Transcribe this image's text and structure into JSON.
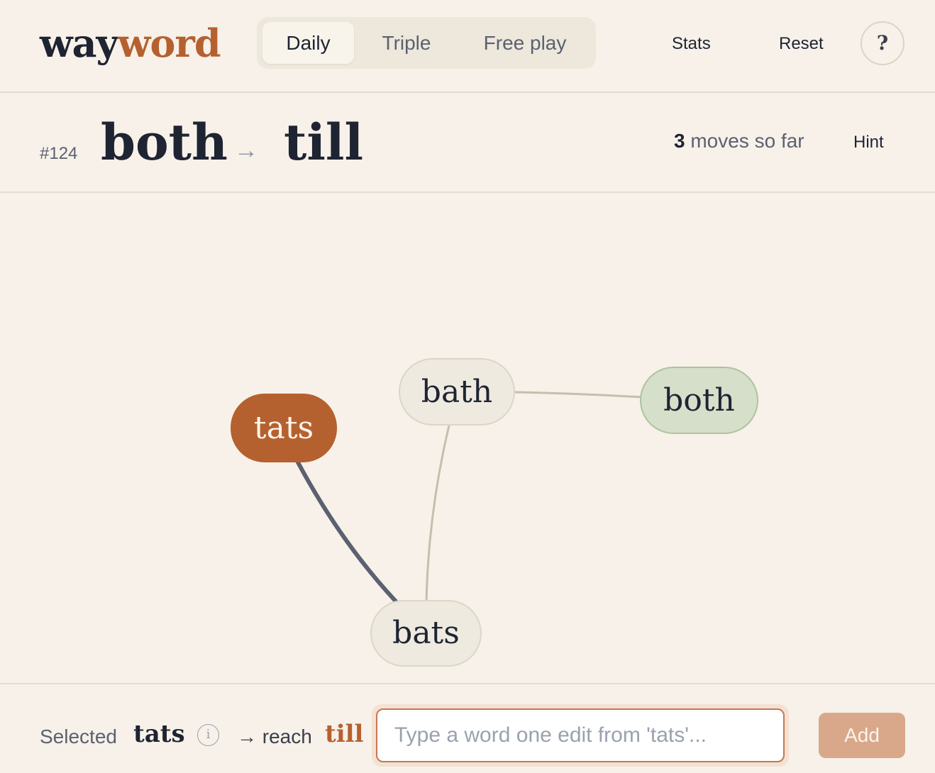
{
  "app": {
    "logo_part1": "way",
    "logo_part2": "word"
  },
  "header": {
    "modes": [
      {
        "label": "Daily",
        "active": true
      },
      {
        "label": "Triple",
        "active": false
      },
      {
        "label": "Free play",
        "active": false
      }
    ],
    "stats_label": "Stats",
    "reset_label": "Reset",
    "help_label": "?"
  },
  "puzzle": {
    "number": "#124",
    "start_word": "both",
    "arrow": "→",
    "target_word": "till",
    "moves_count": "3",
    "moves_suffix": "moves so far",
    "hint_label": "Hint"
  },
  "graph": {
    "nodes": [
      {
        "id": "tats",
        "label": "tats",
        "state": "selected"
      },
      {
        "id": "bath",
        "label": "bath",
        "state": "plain"
      },
      {
        "id": "both",
        "label": "both",
        "state": "start"
      },
      {
        "id": "bats",
        "label": "bats",
        "state": "plain"
      }
    ],
    "edges": [
      {
        "from": "bath",
        "to": "both",
        "highlighted": false
      },
      {
        "from": "bath",
        "to": "bats",
        "highlighted": false
      },
      {
        "from": "tats",
        "to": "bats",
        "highlighted": true
      }
    ],
    "colors": {
      "edge": "#c4bfae",
      "edge_highlight": "#5b6170",
      "accent": "#b5612f",
      "start_fill": "#d5dfca"
    }
  },
  "footer": {
    "selected_label": "Selected",
    "selected_word": "tats",
    "info_icon": "ⓘ",
    "reach_label": "→ reach",
    "target_word": "till",
    "input_placeholder": "Type a word one edit from 'tats'...",
    "input_value": "",
    "add_label": "Add"
  }
}
